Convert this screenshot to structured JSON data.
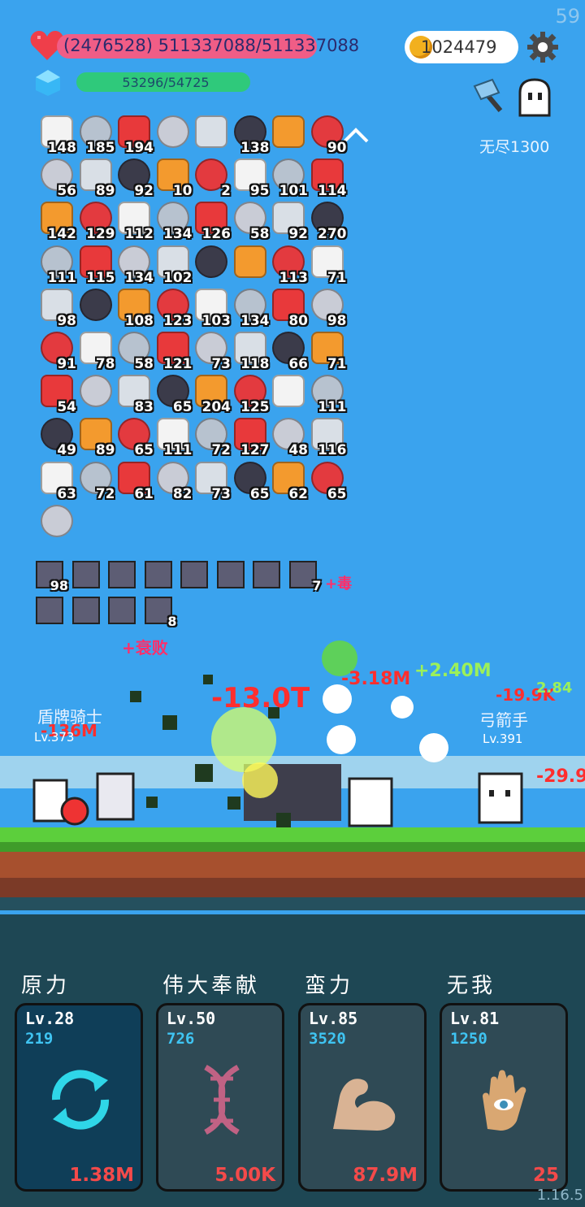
{
  "fps": "59",
  "version": "1.16.5",
  "status": {
    "hp_text": "(2476528) 511337088/511337088",
    "hp_fraction": 1.0,
    "xp_text": "53296/54725",
    "xp_fraction": 0.974,
    "gold": "1024479",
    "mode_label": "无尽1300"
  },
  "items": [
    [
      "148",
      "185",
      "194",
      "",
      "",
      "138",
      "",
      "90"
    ],
    [
      "56",
      "89",
      "92",
      "10",
      "2",
      "95",
      "101",
      "114"
    ],
    [
      "142",
      "129",
      "112",
      "134",
      "126",
      "58",
      "92",
      "270"
    ],
    [
      "111",
      "115",
      "134",
      "102",
      "",
      "",
      "113",
      "71"
    ],
    [
      "98",
      "",
      "108",
      "123",
      "103",
      "134",
      "80",
      "98"
    ],
    [
      "91",
      "78",
      "58",
      "121",
      "73",
      "118",
      "66",
      "71"
    ],
    [
      "54",
      "",
      "83",
      "65",
      "204",
      "125",
      "",
      "111"
    ],
    [
      "49",
      "89",
      "65",
      "111",
      "72",
      "127",
      "48",
      "116"
    ],
    [
      "63",
      "72",
      "61",
      "82",
      "73",
      "65",
      "62",
      "65"
    ],
    [
      ""
    ]
  ],
  "item_icons": [
    [
      "egg-icon",
      "sword-icon",
      "apple-icon",
      "hook-icon",
      "blade-icon",
      "bat-icon",
      "torch-icon",
      "strawberry-icon"
    ],
    [
      "potion-icon",
      "shield-icon",
      "bulb-icon",
      "speech-icon",
      "magnet-icon",
      "flag-icon",
      "gift-icon",
      "card-icon"
    ],
    [
      "icecream-icon",
      "note-icon",
      "heart-icon",
      "watermelon-icon",
      "pill-icon",
      "thermometer-icon",
      "spikeball-icon",
      "star-card-icon"
    ],
    [
      "jam-icon",
      "cactus-icon",
      "book-icon",
      "cash-icon",
      "list-icon",
      "helmet-icon",
      "mushroom-icon",
      "bubble-icon"
    ],
    [
      "meteor-icon",
      "grenade-icon",
      "crown-icon",
      "fried-egg-icon",
      "orb-icon",
      "armor-icon",
      "chest-icon",
      "fist-icon"
    ],
    [
      "cauldron-icon",
      "halo-icon",
      "bunny-icon",
      "door-icon",
      "cloud-icon",
      "sock-icon",
      "mail-icon",
      "bow-icon"
    ],
    [
      "target-icon",
      "ghost-icon",
      "axe-icon",
      "scroll-icon",
      "shield-round-icon",
      "donut-icon",
      "noose-icon",
      "dice-icon"
    ],
    [
      "wine-icon",
      "ring-icon",
      "wand-icon",
      "helmet-green-icon",
      "capsule-icon",
      "playing-card-icon",
      "gem-icon",
      "sunflower-icon"
    ],
    [
      "heart-plus-icon",
      "slime-icon",
      "clipboard-icon",
      "chat-icon",
      "coconut-icon",
      "red-card-icon",
      "steak-icon",
      "scroll-gold-icon"
    ],
    [
      "coins-icon"
    ]
  ],
  "item_colors": [
    "#f3f3f3",
    "#b7c2cf",
    "#e8393b",
    "#c9ccd6",
    "#d9dfe6",
    "#3b3b4a",
    "#f39a2e",
    "#e33a3f"
  ],
  "buffs": [
    {
      "name": "buff-sword",
      "label": "98"
    },
    {
      "name": "buff-sun",
      "label": ""
    },
    {
      "name": "buff-strike",
      "label": ""
    },
    {
      "name": "buff-dagger",
      "label": ""
    },
    {
      "name": "buff-skull",
      "label": ""
    },
    {
      "name": "buff-slash",
      "label": ""
    },
    {
      "name": "buff-heart-shield",
      "label": ""
    },
    {
      "name": "buff-sword2",
      "label": "7"
    },
    {
      "name": "buff-axe",
      "label": ""
    },
    {
      "name": "buff-castle",
      "label": ""
    },
    {
      "name": "buff-wolf",
      "label": ""
    },
    {
      "name": "buff-sword3",
      "label": "8"
    }
  ],
  "battle": {
    "left_name": "盾牌骑士",
    "left_level": "Lv.373",
    "right_name": "弓箭手",
    "right_level": "Lv.391",
    "popups": [
      {
        "text": "+毒",
        "color": "#ff2e6a"
      },
      {
        "text": "+衰败",
        "color": "#ff2e6a"
      },
      {
        "text": "-13.0T",
        "color": "#ff2e2e"
      },
      {
        "text": "-136M",
        "color": "#ff2e2e"
      },
      {
        "text": "+2.40M",
        "color": "#9cf05a"
      },
      {
        "text": "-19.9K",
        "color": "#ff2e2e"
      },
      {
        "text": "-29.9",
        "color": "#ff2e2e"
      },
      {
        "text": "-3.18M",
        "color": "#ff2e2e"
      },
      {
        "text": "2.84",
        "color": "#9cf05a"
      }
    ]
  },
  "skills": [
    {
      "title": "原力",
      "level": "Lv.28",
      "cost": "219",
      "value": "1.38M",
      "icon": "refresh-icon",
      "color": "#2fd6e8"
    },
    {
      "title": "伟大奉献",
      "level": "Lv.50",
      "cost": "726",
      "value": "5.00K",
      "icon": "dna-icon",
      "color": "#c56a8a"
    },
    {
      "title": "蛮力",
      "level": "Lv.85",
      "cost": "3520",
      "value": "87.9M",
      "icon": "muscle-icon",
      "color": "#e9c09e"
    },
    {
      "title": "无我",
      "level": "Lv.81",
      "cost": "1250",
      "value": "25",
      "icon": "hand-eye-icon",
      "color": "#e3b07a"
    }
  ]
}
